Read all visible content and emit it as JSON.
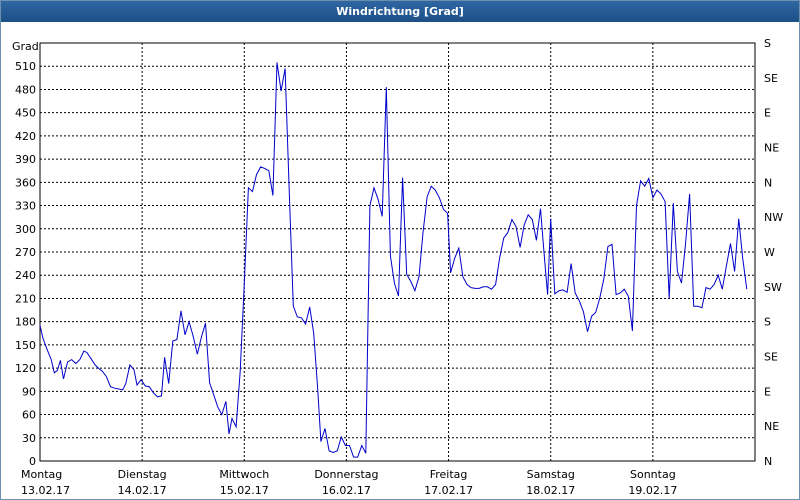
{
  "window": {
    "title": "Windrichtung [Grad]"
  },
  "chart_data": {
    "type": "line",
    "title": "Windrichtung [Grad]",
    "ylabel": "Grad",
    "ylim": [
      0,
      540
    ],
    "grid": true,
    "yticks": [
      0,
      30,
      60,
      90,
      120,
      150,
      180,
      210,
      240,
      270,
      300,
      330,
      360,
      390,
      420,
      450,
      480,
      510
    ],
    "y2_labels": [
      "N",
      "NE",
      "E",
      "SE",
      "S",
      "SW",
      "W",
      "NW",
      "N",
      "NE",
      "E",
      "SE",
      "S"
    ],
    "y2_values": [
      0,
      45,
      90,
      135,
      180,
      225,
      270,
      315,
      360,
      405,
      450,
      495,
      540
    ],
    "x_categories": [
      {
        "day": "Montag",
        "date": "13.02.17"
      },
      {
        "day": "Dienstag",
        "date": "14.02.17"
      },
      {
        "day": "Mittwoch",
        "date": "15.02.17"
      },
      {
        "day": "Donnerstag",
        "date": "16.02.17"
      },
      {
        "day": "Freitag",
        "date": "17.02.17"
      },
      {
        "day": "Samstag",
        "date": "18.02.17"
      },
      {
        "day": "Sonntag",
        "date": "19.02.17"
      }
    ],
    "xlim": [
      0,
      7
    ],
    "series": [
      {
        "color": "#0000cc",
        "points": [
          [
            0.0,
            175
          ],
          [
            0.03,
            158
          ],
          [
            0.07,
            144
          ],
          [
            0.11,
            131
          ],
          [
            0.14,
            114
          ],
          [
            0.17,
            117
          ],
          [
            0.2,
            130
          ],
          [
            0.23,
            106
          ],
          [
            0.27,
            128
          ],
          [
            0.31,
            131
          ],
          [
            0.35,
            126
          ],
          [
            0.39,
            131
          ],
          [
            0.43,
            142
          ],
          [
            0.46,
            140
          ],
          [
            0.5,
            132
          ],
          [
            0.54,
            124
          ],
          [
            0.58,
            119
          ],
          [
            0.61,
            116
          ],
          [
            0.65,
            109
          ],
          [
            0.69,
            96
          ],
          [
            0.73,
            94
          ],
          [
            0.77,
            93
          ],
          [
            0.81,
            92
          ],
          [
            0.84,
            100
          ],
          [
            0.88,
            124
          ],
          [
            0.92,
            118
          ],
          [
            0.95,
            98
          ],
          [
            0.99,
            105
          ],
          [
            1.03,
            97
          ],
          [
            1.07,
            96
          ],
          [
            1.11,
            88
          ],
          [
            1.15,
            83
          ],
          [
            1.19,
            84
          ],
          [
            1.22,
            134
          ],
          [
            1.26,
            100
          ],
          [
            1.3,
            155
          ],
          [
            1.34,
            157
          ],
          [
            1.38,
            194
          ],
          [
            1.42,
            163
          ],
          [
            1.46,
            180
          ],
          [
            1.5,
            161
          ],
          [
            1.54,
            138
          ],
          [
            1.58,
            160
          ],
          [
            1.62,
            178
          ],
          [
            1.66,
            101
          ],
          [
            1.7,
            86
          ],
          [
            1.74,
            70
          ],
          [
            1.78,
            60
          ],
          [
            1.82,
            77
          ],
          [
            1.85,
            35
          ],
          [
            1.88,
            55
          ],
          [
            1.92,
            44
          ],
          [
            1.96,
            116
          ],
          [
            2.0,
            230
          ],
          [
            2.04,
            353
          ],
          [
            2.08,
            348
          ],
          [
            2.12,
            370
          ],
          [
            2.16,
            380
          ],
          [
            2.2,
            378
          ],
          [
            2.24,
            375
          ],
          [
            2.28,
            343
          ],
          [
            2.32,
            515
          ],
          [
            2.36,
            478
          ],
          [
            2.4,
            507
          ],
          [
            2.44,
            350
          ],
          [
            2.48,
            200
          ],
          [
            2.52,
            186
          ],
          [
            2.56,
            185
          ],
          [
            2.6,
            177
          ],
          [
            2.64,
            199
          ],
          [
            2.68,
            165
          ],
          [
            2.72,
            91
          ],
          [
            2.75,
            25
          ],
          [
            2.79,
            42
          ],
          [
            2.83,
            13
          ],
          [
            2.87,
            11
          ],
          [
            2.91,
            13
          ],
          [
            2.95,
            31
          ],
          [
            2.99,
            20
          ],
          [
            3.03,
            20
          ],
          [
            3.07,
            5
          ],
          [
            3.11,
            5
          ],
          [
            3.15,
            20
          ],
          [
            3.19,
            10
          ],
          [
            3.23,
            330
          ],
          [
            3.27,
            353
          ],
          [
            3.31,
            338
          ],
          [
            3.35,
            316
          ],
          [
            3.39,
            483
          ],
          [
            3.43,
            265
          ],
          [
            3.47,
            230
          ],
          [
            3.51,
            213
          ],
          [
            3.55,
            366
          ],
          [
            3.59,
            241
          ],
          [
            3.63,
            232
          ],
          [
            3.67,
            220
          ],
          [
            3.71,
            238
          ],
          [
            3.75,
            295
          ],
          [
            3.79,
            341
          ],
          [
            3.83,
            355
          ],
          [
            3.87,
            350
          ],
          [
            3.91,
            340
          ],
          [
            3.95,
            325
          ],
          [
            3.99,
            320
          ],
          [
            4.02,
            243
          ],
          [
            4.06,
            262
          ],
          [
            4.1,
            275
          ],
          [
            4.14,
            238
          ],
          [
            4.18,
            228
          ],
          [
            4.22,
            224
          ],
          [
            4.26,
            223
          ],
          [
            4.3,
            223
          ],
          [
            4.34,
            225
          ],
          [
            4.38,
            225
          ],
          [
            4.42,
            222
          ],
          [
            4.46,
            228
          ],
          [
            4.5,
            262
          ],
          [
            4.54,
            288
          ],
          [
            4.58,
            295
          ],
          [
            4.62,
            312
          ],
          [
            4.66,
            303
          ],
          [
            4.7,
            276
          ],
          [
            4.74,
            305
          ],
          [
            4.78,
            318
          ],
          [
            4.82,
            312
          ],
          [
            4.86,
            285
          ],
          [
            4.9,
            326
          ],
          [
            4.94,
            260
          ],
          [
            4.97,
            215
          ],
          [
            5.0,
            313
          ],
          [
            5.04,
            216
          ],
          [
            5.08,
            220
          ],
          [
            5.12,
            221
          ],
          [
            5.16,
            218
          ],
          [
            5.2,
            255
          ],
          [
            5.24,
            217
          ],
          [
            5.28,
            207
          ],
          [
            5.32,
            193
          ],
          [
            5.36,
            167
          ],
          [
            5.4,
            187
          ],
          [
            5.44,
            192
          ],
          [
            5.48,
            210
          ],
          [
            5.52,
            235
          ],
          [
            5.56,
            277
          ],
          [
            5.6,
            280
          ],
          [
            5.64,
            215
          ],
          [
            5.68,
            217
          ],
          [
            5.72,
            222
          ],
          [
            5.76,
            213
          ],
          [
            5.8,
            168
          ],
          [
            5.84,
            330
          ],
          [
            5.88,
            362
          ],
          [
            5.92,
            355
          ],
          [
            5.96,
            365
          ],
          [
            6.0,
            340
          ],
          [
            6.04,
            350
          ],
          [
            6.08,
            345
          ],
          [
            6.12,
            335
          ],
          [
            6.16,
            210
          ],
          [
            6.2,
            333
          ],
          [
            6.24,
            245
          ],
          [
            6.28,
            230
          ],
          [
            6.32,
            280
          ],
          [
            6.36,
            345
          ],
          [
            6.4,
            200
          ],
          [
            6.44,
            200
          ],
          [
            6.48,
            198
          ],
          [
            6.52,
            224
          ],
          [
            6.56,
            222
          ],
          [
            6.6,
            228
          ],
          [
            6.64,
            240
          ],
          [
            6.68,
            222
          ],
          [
            6.72,
            252
          ],
          [
            6.76,
            281
          ],
          [
            6.8,
            245
          ],
          [
            6.84,
            313
          ],
          [
            6.88,
            262
          ],
          [
            6.92,
            222
          ]
        ]
      }
    ]
  }
}
